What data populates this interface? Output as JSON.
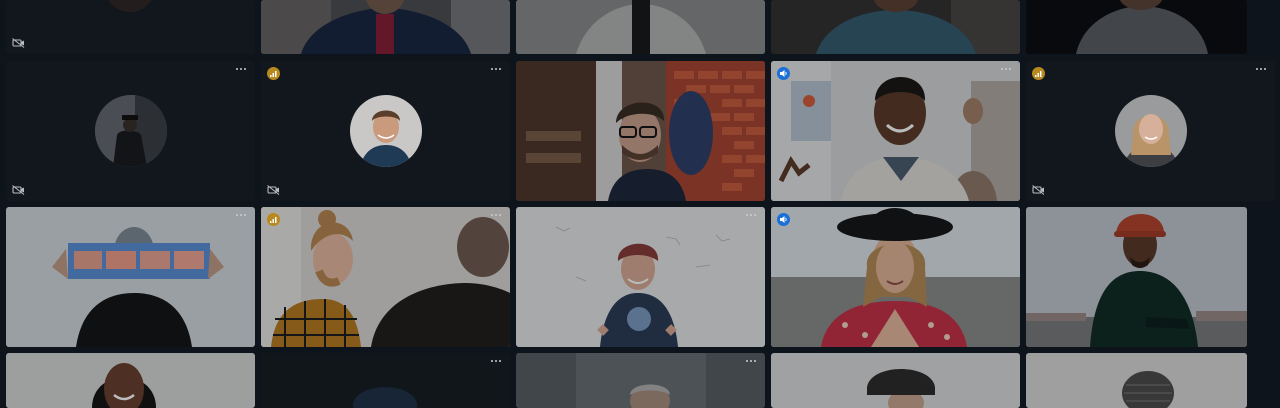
{
  "screen": {
    "background": "#0d141c"
  },
  "controls": {
    "more_options_icon": "more-horizontal-icon",
    "camera_off_icon": "video-off-icon",
    "gold_badge_icon": "signal-icon",
    "blue_badge_icon": "speaker-icon"
  },
  "colors": {
    "gold_badge": "#b8891f",
    "blue_badge": "#1c6fd6",
    "tile_off": "#12171d"
  },
  "participants": [
    {
      "row": 1,
      "col": 1,
      "video": "off",
      "camera_off": true
    },
    {
      "row": 1,
      "col": 2,
      "video": "on"
    },
    {
      "row": 1,
      "col": 3,
      "video": "on"
    },
    {
      "row": 1,
      "col": 4,
      "video": "on"
    },
    {
      "row": 1,
      "col": 5,
      "video": "on"
    },
    {
      "row": 2,
      "col": 1,
      "video": "off",
      "avatar": true,
      "camera_off": true,
      "more_options": true
    },
    {
      "row": 2,
      "col": 2,
      "video": "off",
      "avatar": true,
      "camera_off": true,
      "more_options": true,
      "badge": "gold"
    },
    {
      "row": 2,
      "col": 3,
      "video": "on"
    },
    {
      "row": 2,
      "col": 4,
      "video": "on",
      "more_options": true,
      "badge": "blue"
    },
    {
      "row": 2,
      "col": 5,
      "video": "off",
      "avatar": true,
      "camera_off": true,
      "more_options": true,
      "badge": "gold"
    },
    {
      "row": 3,
      "col": 1,
      "video": "on",
      "more_options": true
    },
    {
      "row": 3,
      "col": 2,
      "video": "on",
      "more_options": true,
      "badge": "gold"
    },
    {
      "row": 3,
      "col": 3,
      "video": "on",
      "more_options": true
    },
    {
      "row": 3,
      "col": 4,
      "video": "on",
      "badge": "blue"
    },
    {
      "row": 3,
      "col": 5,
      "video": "on"
    },
    {
      "row": 4,
      "col": 1,
      "video": "on"
    },
    {
      "row": 4,
      "col": 2,
      "video": "on",
      "more_options": true
    },
    {
      "row": 4,
      "col": 3,
      "video": "on",
      "more_options": true
    },
    {
      "row": 4,
      "col": 4,
      "video": "on"
    },
    {
      "row": 4,
      "col": 5,
      "video": "on"
    }
  ]
}
